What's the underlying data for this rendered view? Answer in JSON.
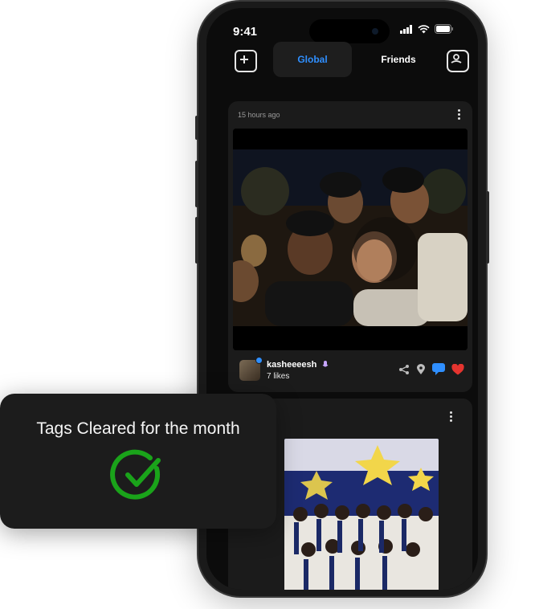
{
  "status_bar": {
    "time": "9:41"
  },
  "header": {
    "tabs": [
      {
        "label": "Global",
        "active": true
      },
      {
        "label": "Friends",
        "active": false
      }
    ],
    "left_icon": "add-square-icon",
    "right_icon": "profile-box-icon"
  },
  "posts": [
    {
      "timestamp": "15 hours ago",
      "username": "kasheeeesh",
      "likes": "7 likes",
      "actions": [
        "share-icon",
        "location-icon",
        "comment-icon",
        "heart-icon"
      ]
    },
    {
      "timestamp": ""
    }
  ],
  "toast": {
    "message": "Tags Cleared for the month",
    "icon": "check-circle-icon",
    "accent": "#1aa31a"
  },
  "colors": {
    "accent_blue": "#2f8fff",
    "heart_red": "#e5342f",
    "comment_blue": "#2f8fff"
  }
}
